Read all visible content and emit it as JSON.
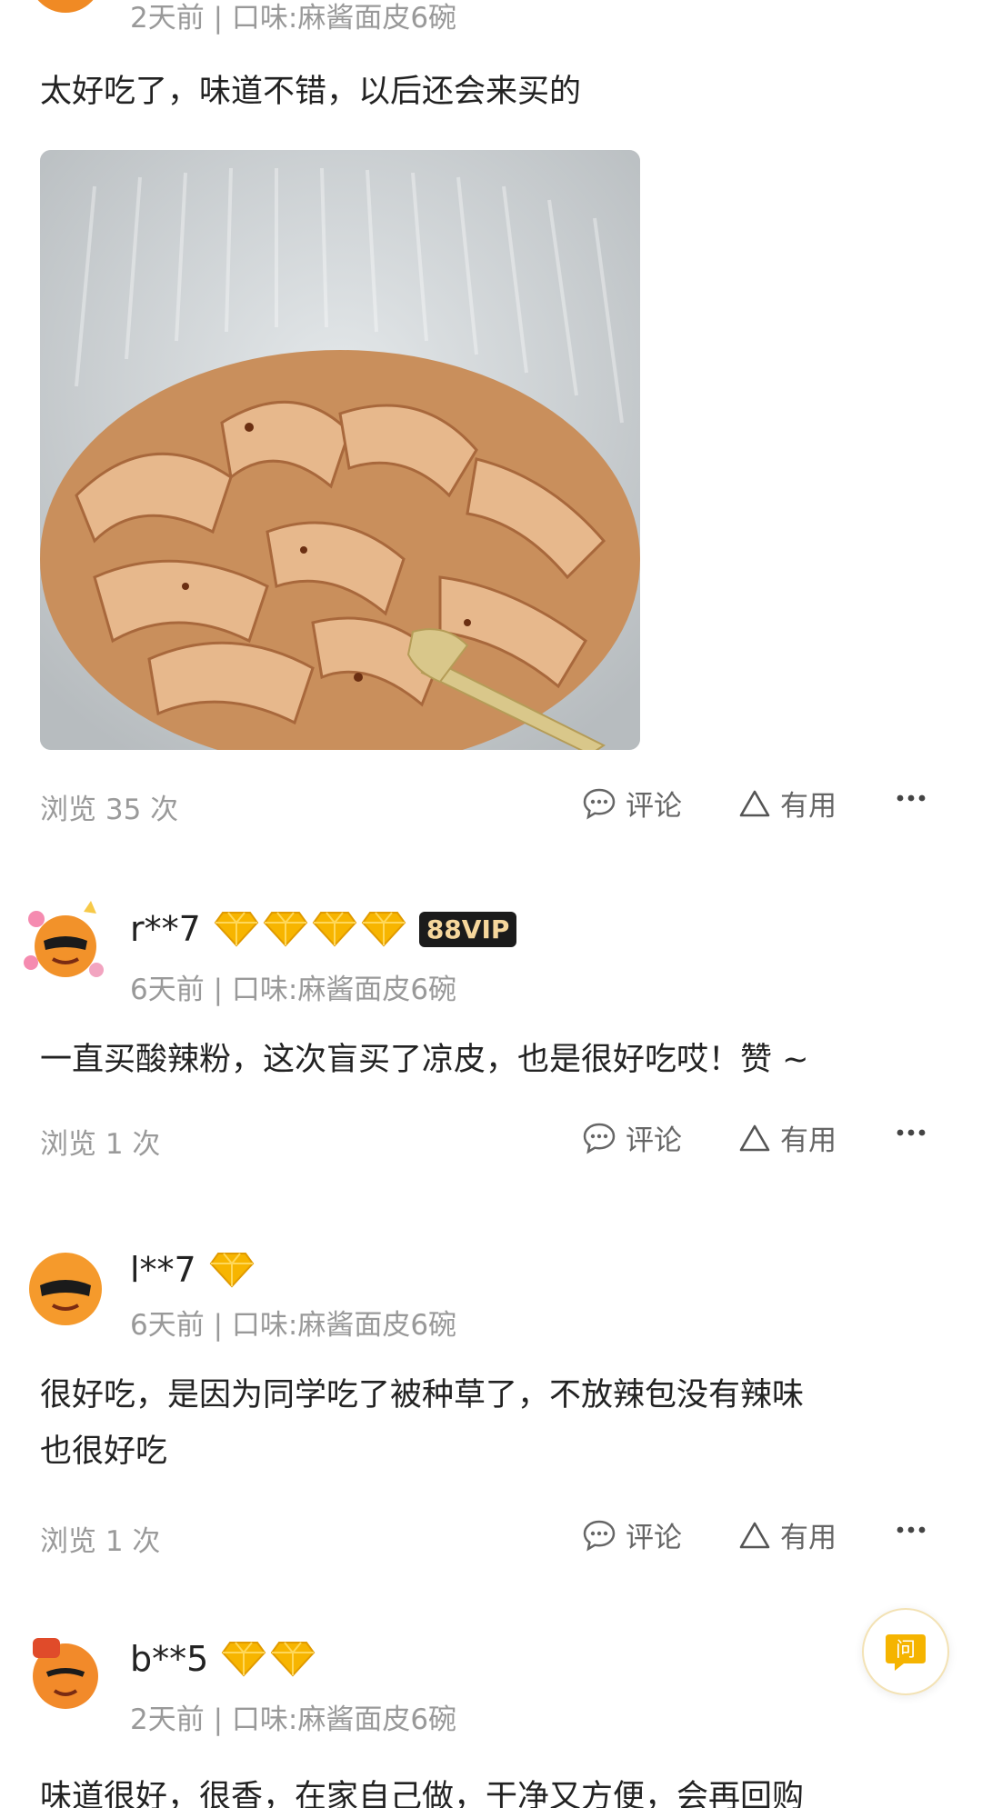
{
  "reviews": [
    {
      "meta": "2天前 | 口味:麻酱面皮6碗",
      "text": "太好吃了，味道不错，以后还会来买的",
      "views": "浏览 35 次",
      "comment": "评论",
      "useful": "有用"
    },
    {
      "username": "r**7",
      "diamonds": 4,
      "vip": "88VIP",
      "meta": "6天前 | 口味:麻酱面皮6碗",
      "text": "一直买酸辣粉，这次盲买了凉皮，也是很好吃哎！赞 ~",
      "views": "浏览 1 次",
      "comment": "评论",
      "useful": "有用"
    },
    {
      "username": "l**7",
      "diamonds": 1,
      "meta": "6天前 | 口味:麻酱面皮6碗",
      "text_line1": "很好吃，是因为同学吃了被种草了，不放辣包没有辣味",
      "text_line2": "也很好吃",
      "views": "浏览 1 次",
      "comment": "评论",
      "useful": "有用"
    },
    {
      "username": "b**5",
      "diamonds": 2,
      "meta": "2天前 | 口味:麻酱面皮6碗",
      "text": "味道很好，很香，在家自己做，干净又方便，会再回购"
    }
  ],
  "ask_button": "问",
  "colors": {
    "accent": "#f5b400",
    "muted": "#999999",
    "text": "#222222"
  },
  "icons": [
    "diamond-icon",
    "comment-icon",
    "useful-triangle-icon",
    "more-icon",
    "ask-icon"
  ]
}
